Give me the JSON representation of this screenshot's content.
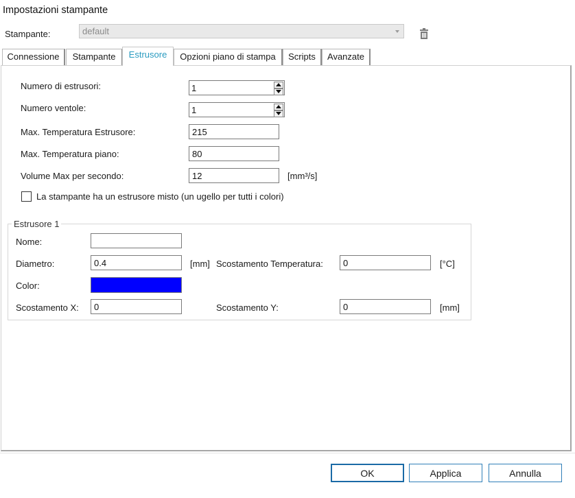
{
  "window": {
    "title": "Impostazioni stampante"
  },
  "printer": {
    "label": "Stampante:",
    "selected": "default"
  },
  "tabs": [
    {
      "label": "Connessione"
    },
    {
      "label": "Stampante"
    },
    {
      "label": "Estrusore"
    },
    {
      "label": "Opzioni piano di stampa"
    },
    {
      "label": "Scripts"
    },
    {
      "label": "Avanzate"
    }
  ],
  "extruder_tab": {
    "num_extruders": {
      "label": "Numero di estrusori:",
      "value": "1"
    },
    "num_fans": {
      "label": "Numero ventole:",
      "value": "1"
    },
    "max_extruder_temp": {
      "label": "Max. Temperatura Estrusore:",
      "value": "215"
    },
    "max_bed_temp": {
      "label": "Max. Temperatura piano:",
      "value": "80"
    },
    "max_volume": {
      "label": "Volume Max per secondo:",
      "value": "12",
      "unit": "[mm³/s]"
    },
    "mixing_extruder": {
      "label": "La stampante ha un estrusore misto (un ugello per tutti i colori)",
      "checked": false
    },
    "extruder1": {
      "title": "Estrusore 1",
      "name": {
        "label": "Nome:",
        "value": ""
      },
      "diameter": {
        "label": "Diametro:",
        "value": "0.4",
        "unit": "[mm]"
      },
      "temp_offset": {
        "label": "Scostamento Temperatura:",
        "value": "0",
        "unit": "[°C]"
      },
      "color": {
        "label": "Color:",
        "value": "#0000ff"
      },
      "offset_x": {
        "label": "Scostamento X:",
        "value": "0"
      },
      "offset_y": {
        "label": "Scostamento Y:",
        "value": "0",
        "unit": "[mm]"
      }
    }
  },
  "buttons": {
    "ok": "OK",
    "apply": "Applica",
    "cancel": "Annulla"
  },
  "colors": {
    "active_tab": "#2a9bc0",
    "button_border": "#2f7fb8"
  },
  "icons": {
    "delete": "trash-icon",
    "dropdown": "chevron-down-icon"
  }
}
